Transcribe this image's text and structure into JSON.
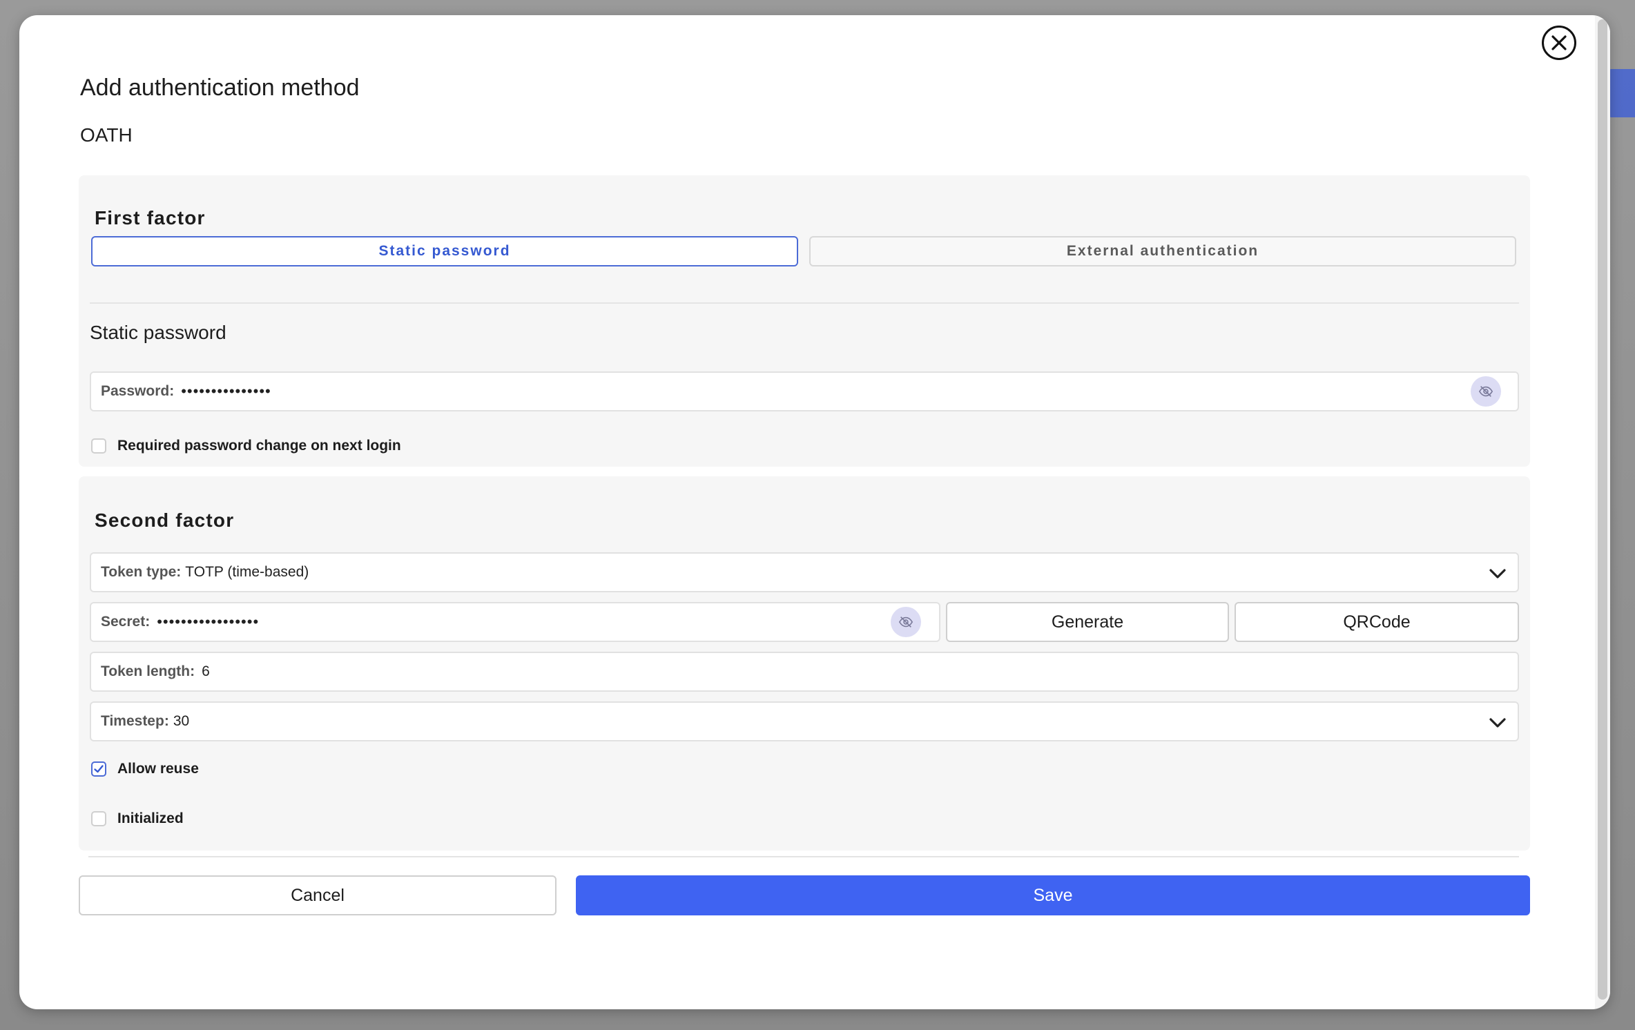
{
  "modal": {
    "title": "Add authentication method",
    "subtitle": "OATH"
  },
  "first_factor": {
    "title": "First factor",
    "tabs": [
      {
        "label": "Static password",
        "active": true
      },
      {
        "label": "External authentication",
        "active": false
      }
    ],
    "subheading": "Static password",
    "password": {
      "label": "Password:",
      "value": "•••••••••••••••"
    },
    "required_change": {
      "label": "Required password change on next login",
      "checked": false
    }
  },
  "second_factor": {
    "title": "Second factor",
    "token_type": {
      "label": "Token type:",
      "value": "TOTP (time-based)"
    },
    "secret": {
      "label": "Secret:",
      "value": "•••••••••••••••••"
    },
    "generate_label": "Generate",
    "qrcode_label": "QRCode",
    "token_length": {
      "label": "Token length:",
      "value": "6"
    },
    "timestep": {
      "label": "Timestep:",
      "value": "30"
    },
    "allow_reuse": {
      "label": "Allow reuse",
      "checked": true
    },
    "initialized": {
      "label": "Initialized",
      "checked": false
    }
  },
  "actions": {
    "cancel_label": "Cancel",
    "save_label": "Save"
  },
  "icons": {
    "close": "close-icon",
    "eye": "eye-off-icon",
    "chevron": "chevron-down-icon",
    "check": "check-icon"
  },
  "colors": {
    "accent": "#3f63f2",
    "tab_active": "#3559d1",
    "eye_bg": "#dcdcf4"
  }
}
